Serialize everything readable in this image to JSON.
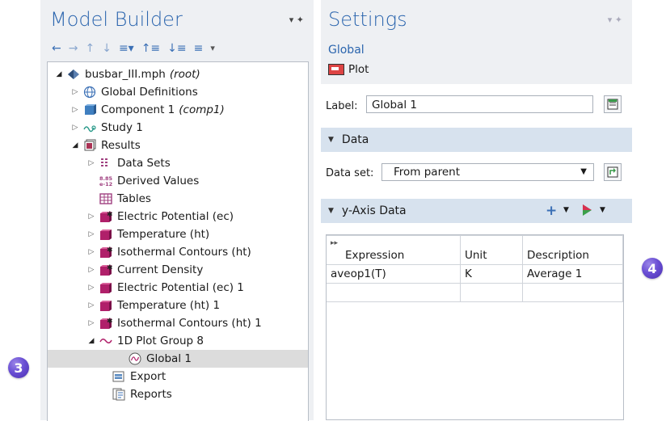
{
  "callouts": {
    "left": "3",
    "right": "4"
  },
  "model_builder": {
    "title": "Model Builder",
    "controls": "▾ ✦",
    "toolbar": [
      "←",
      "→",
      "↑",
      "↓",
      "≡▾",
      "↑≡",
      "↓≡",
      "≡",
      "▾"
    ],
    "tree": [
      {
        "label": "busbar_III.mph",
        "suffix": "(root)",
        "icon": "model-diamond-icon"
      },
      {
        "label": "Global Definitions",
        "suffix": "",
        "icon": "globe-icon"
      },
      {
        "label": "Component 1",
        "suffix": "(comp1)",
        "icon": "component-cube-icon"
      },
      {
        "label": "Study 1",
        "suffix": "",
        "icon": "study-icon"
      },
      {
        "label": "Results",
        "suffix": "",
        "icon": "results-icon"
      },
      {
        "label": "Data Sets",
        "suffix": "",
        "icon": "datasets-icon"
      },
      {
        "label": "Derived Values",
        "suffix": "",
        "icon": "derived-values-icon"
      },
      {
        "label": "Tables",
        "suffix": "",
        "icon": "table-icon"
      },
      {
        "label": "Electric Potential (ec)",
        "suffix": "",
        "icon": "plot-group-3d-icon"
      },
      {
        "label": "Temperature (ht)",
        "suffix": "",
        "icon": "plot-group-3d-icon"
      },
      {
        "label": "Isothermal Contours (ht)",
        "suffix": "",
        "icon": "plot-group-3d-star-icon"
      },
      {
        "label": "Current Density",
        "suffix": "",
        "icon": "plot-group-3d-star-icon"
      },
      {
        "label": "Electric Potential (ec) 1",
        "suffix": "",
        "icon": "plot-group-3d-icon"
      },
      {
        "label": "Temperature (ht) 1",
        "suffix": "",
        "icon": "plot-group-3d-icon"
      },
      {
        "label": "Isothermal Contours (ht) 1",
        "suffix": "",
        "icon": "plot-group-3d-star-icon"
      },
      {
        "label": "1D Plot Group 8",
        "suffix": "",
        "icon": "plot-group-1d-icon"
      },
      {
        "label": "Global 1",
        "suffix": "",
        "icon": "global-plot-icon"
      },
      {
        "label": "Export",
        "suffix": "",
        "icon": "export-icon"
      },
      {
        "label": "Reports",
        "suffix": "",
        "icon": "reports-icon"
      }
    ]
  },
  "settings": {
    "title": "Settings",
    "controls": "▾ ✦",
    "subtitle": "Global",
    "type_label": "Plot",
    "label_caption": "Label:",
    "label_value": "Global 1",
    "data_section": "Data",
    "dataset_caption": "Data set:",
    "dataset_value": "From parent",
    "yaxis_section": "y-Axis Data",
    "table": {
      "headers": [
        "Expression",
        "Unit",
        "Description"
      ],
      "rows": [
        [
          "aveop1(T)",
          "K",
          "Average 1"
        ],
        [
          "",
          "",
          ""
        ]
      ]
    }
  }
}
